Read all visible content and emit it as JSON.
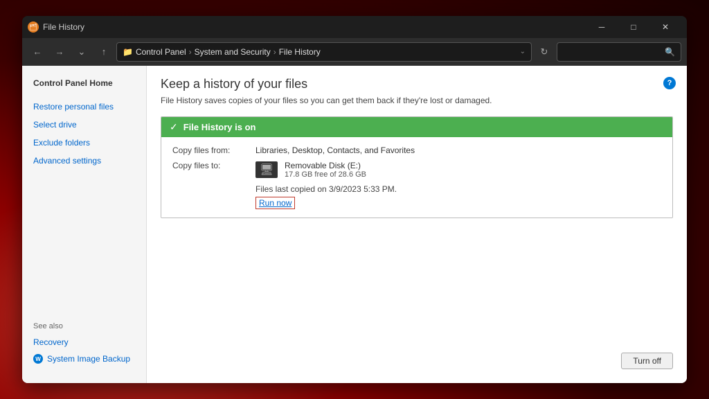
{
  "titlebar": {
    "icon": "🗂",
    "title": "File History",
    "minimize": "─",
    "maximize": "□",
    "close": "✕"
  },
  "addressbar": {
    "back": "←",
    "forward": "→",
    "dropdown": "∨",
    "up": "↑",
    "folder_icon": "📁",
    "breadcrumb": {
      "part1": "Control Panel",
      "sep1": "›",
      "part2": "System and Security",
      "sep2": "›",
      "part3": "File History"
    },
    "addr_dropdown": "∨",
    "refresh": "↻",
    "search_icon": "🔍"
  },
  "sidebar": {
    "active_item": "Control Panel Home",
    "items": [
      {
        "label": "Restore personal files",
        "active": false
      },
      {
        "label": "Select drive",
        "active": false
      },
      {
        "label": "Exclude folders",
        "active": false
      },
      {
        "label": "Advanced settings",
        "active": false
      }
    ],
    "see_also_label": "See also",
    "see_also_items": [
      {
        "label": "Recovery",
        "has_icon": false
      },
      {
        "label": "System Image Backup",
        "has_icon": true
      }
    ]
  },
  "main": {
    "page_title": "Keep a history of your files",
    "page_subtitle": "File History saves copies of your files so you can get them back if they're lost or damaged.",
    "status_header": "File History is on",
    "copy_from_label": "Copy files from:",
    "copy_from_value": "Libraries, Desktop, Contacts, and Favorites",
    "copy_to_label": "Copy files to:",
    "drive_name": "Removable Disk (E:)",
    "drive_size": "17.8 GB free of 28.6 GB",
    "last_copied": "Files last copied on 3/9/2023 5:33 PM.",
    "run_now": "Run now",
    "turn_off": "Turn off",
    "help": "?"
  }
}
